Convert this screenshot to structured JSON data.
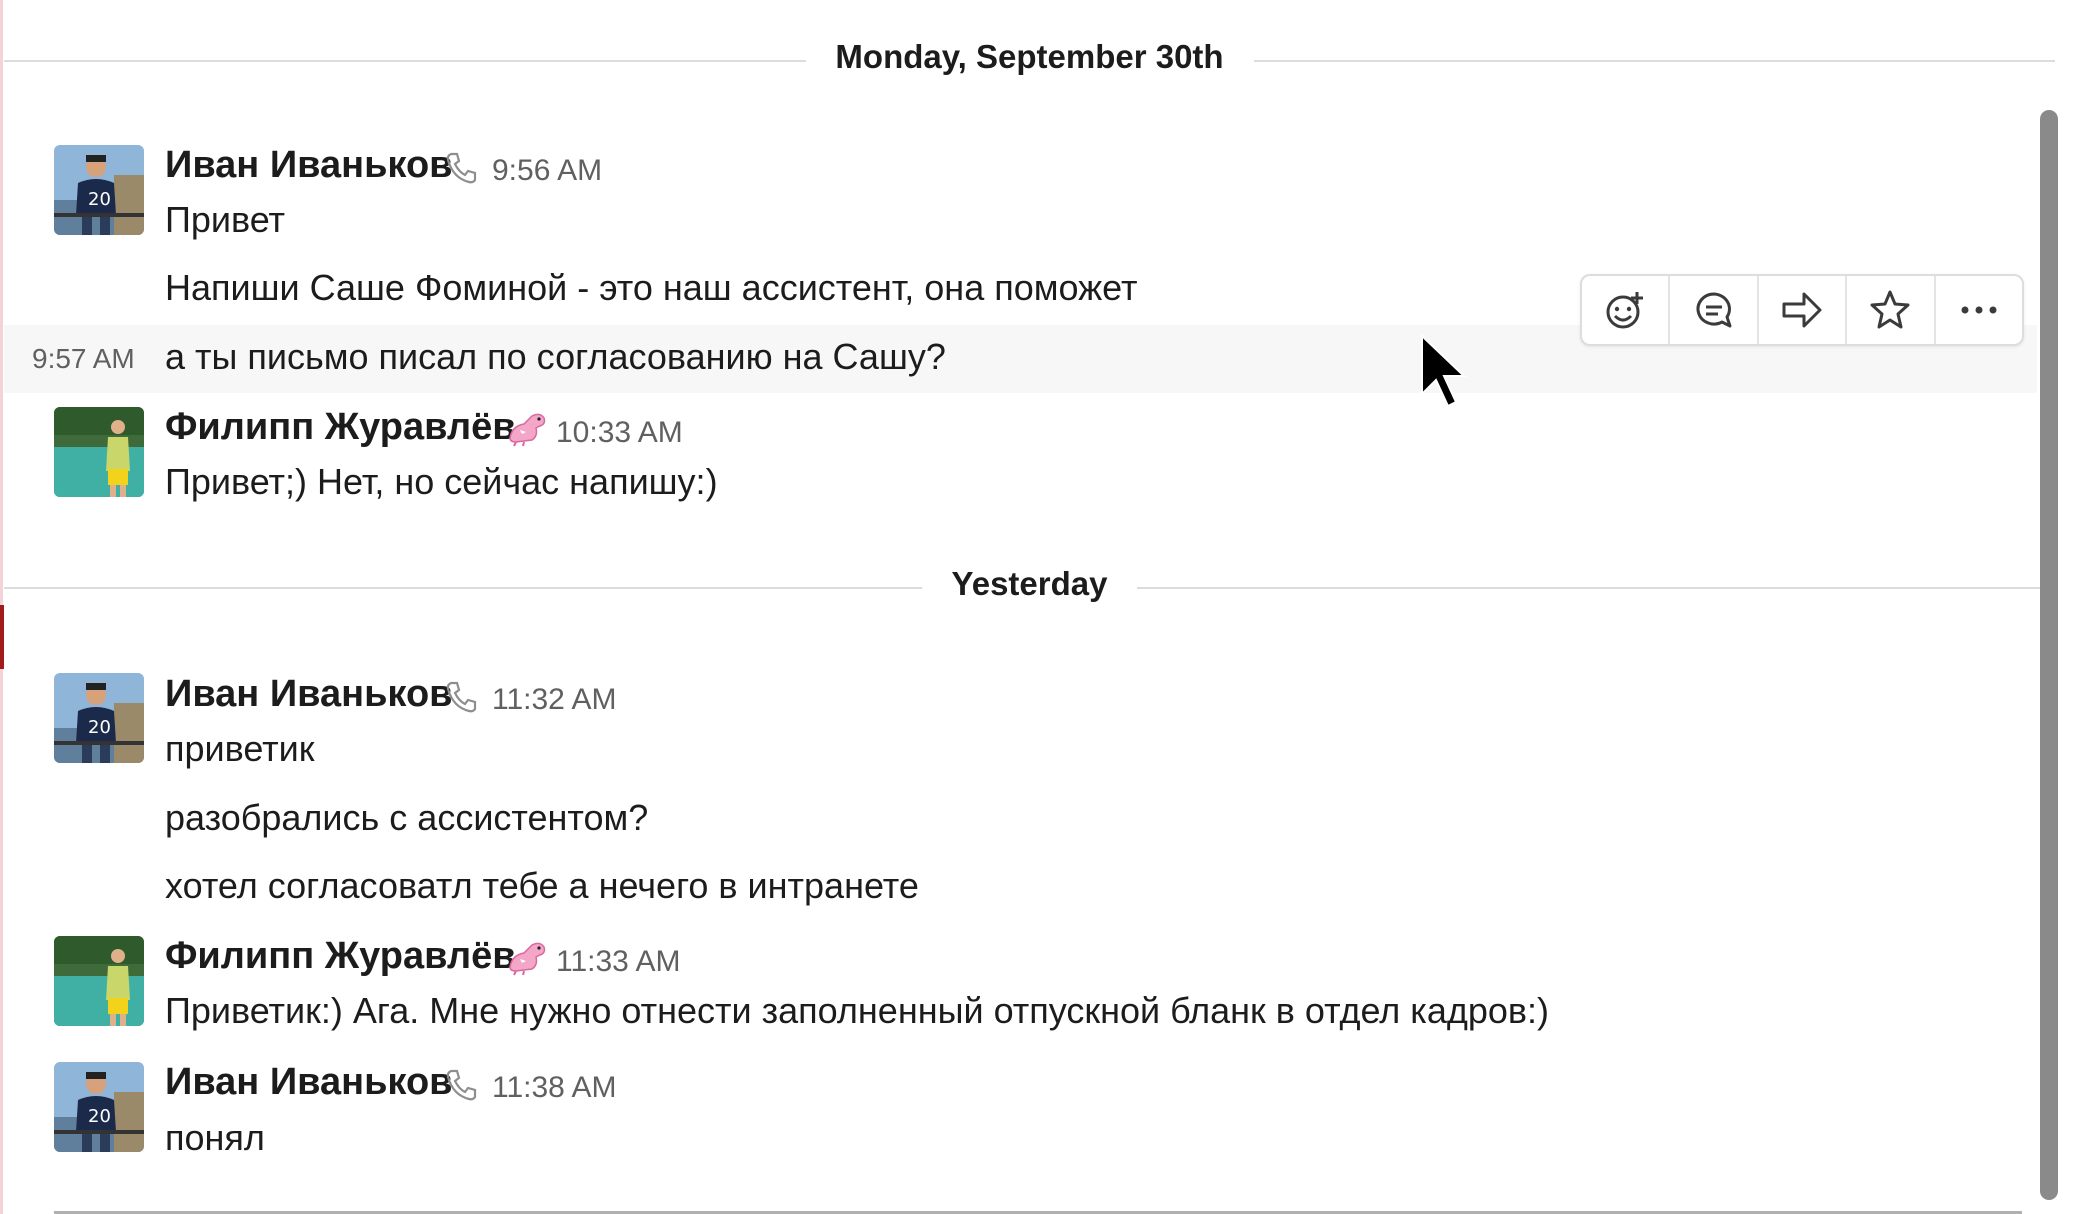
{
  "dividers": {
    "first": "Monday, September 30th",
    "second": "Yesterday"
  },
  "messages": {
    "m1": {
      "sender": "Иван Иваньков",
      "time": "9:56 AM",
      "lines": [
        "Привет",
        "Напиши Саше Фоминой - это наш ассистент, она поможет"
      ],
      "status_icon": "phone-icon"
    },
    "m1b": {
      "time": "9:57 AM",
      "text": "а ты письмо писал по согласованию на Сашу?"
    },
    "m2": {
      "sender": "Филипп Журавлёв",
      "time": "10:33 AM",
      "text": "Привет;) Нет, но сейчас напишу:)",
      "status_icon": "pink-dragon-emoji"
    },
    "m3": {
      "sender": "Иван Иваньков",
      "time": "11:32 AM",
      "lines": [
        "приветик",
        "разобрались с ассистентом?",
        "хотел согласоватл тебе а нечего в интранете"
      ],
      "status_icon": "phone-icon"
    },
    "m4": {
      "sender": "Филипп Журавлёв",
      "time": "11:33 AM",
      "text": "Приветик:) Ага. Мне нужно отнести заполненный отпускной бланк в отдел кадров:)",
      "status_icon": "pink-dragon-emoji"
    },
    "m5": {
      "sender": "Иван Иваньков",
      "time": "11:38 AM",
      "text": "понял",
      "status_icon": "phone-icon"
    }
  },
  "toolbar": {
    "icons": [
      "add-reaction-icon",
      "reply-thread-icon",
      "share-icon",
      "star-icon",
      "more-actions-icon"
    ]
  },
  "colors": {
    "text": "#1d1c1d",
    "muted": "#616061",
    "hover_row": "#f7f7f7",
    "divider": "#dcdcdc"
  }
}
